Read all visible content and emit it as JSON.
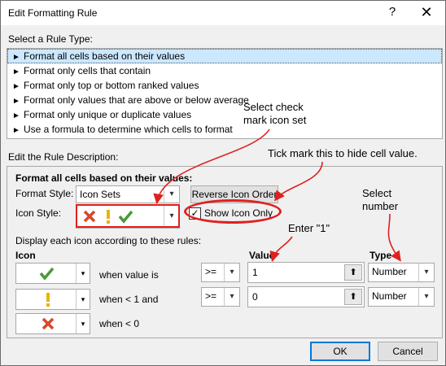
{
  "window": {
    "title": "Edit Formatting Rule",
    "help_glyph": "?",
    "close_glyph": "✕"
  },
  "rule_type": {
    "label": "Select a Rule Type:",
    "items": [
      "Format all cells based on their values",
      "Format only cells that contain",
      "Format only top or bottom ranked values",
      "Format only values that are above or below average",
      "Format only unique or duplicate values",
      "Use a formula to determine which cells to format"
    ],
    "selected_index": 0
  },
  "description": {
    "label": "Edit the Rule Description:",
    "heading": "Format all cells based on their values:",
    "format_style_label": "Format Style:",
    "format_style_value": "Icon Sets",
    "reverse_button": "Reverse Icon Order",
    "icon_style_label": "Icon Style:",
    "show_icon_only_label": "Show Icon Only",
    "show_icon_only_checked": true,
    "rules_caption": "Display each icon according to these rules:",
    "col_icon": "Icon",
    "col_value": "Value",
    "col_type": "Type",
    "rows": [
      {
        "icon": "green-check-icon",
        "condition": "when value is",
        "operator": ">=",
        "value": "1",
        "type": "Number"
      },
      {
        "icon": "yellow-exclamation-icon",
        "condition": "when < 1 and",
        "operator": ">=",
        "value": "0",
        "type": "Number"
      },
      {
        "icon": "red-x-icon",
        "condition": "when < 0"
      }
    ]
  },
  "footer": {
    "ok": "OK",
    "cancel": "Cancel"
  },
  "annotations": {
    "select_icon_set_line1": "Select check",
    "select_icon_set_line2": "mark icon set",
    "tick_mark": "Tick mark this to hide cell value.",
    "enter_one": "Enter \"1\"",
    "select_number_line1": "Select",
    "select_number_line2": "number"
  },
  "colors": {
    "annotation_red": "#e02020",
    "check_green": "#4a9a3b",
    "exclaim_yellow": "#e8b400",
    "x_red": "#d9472b"
  }
}
